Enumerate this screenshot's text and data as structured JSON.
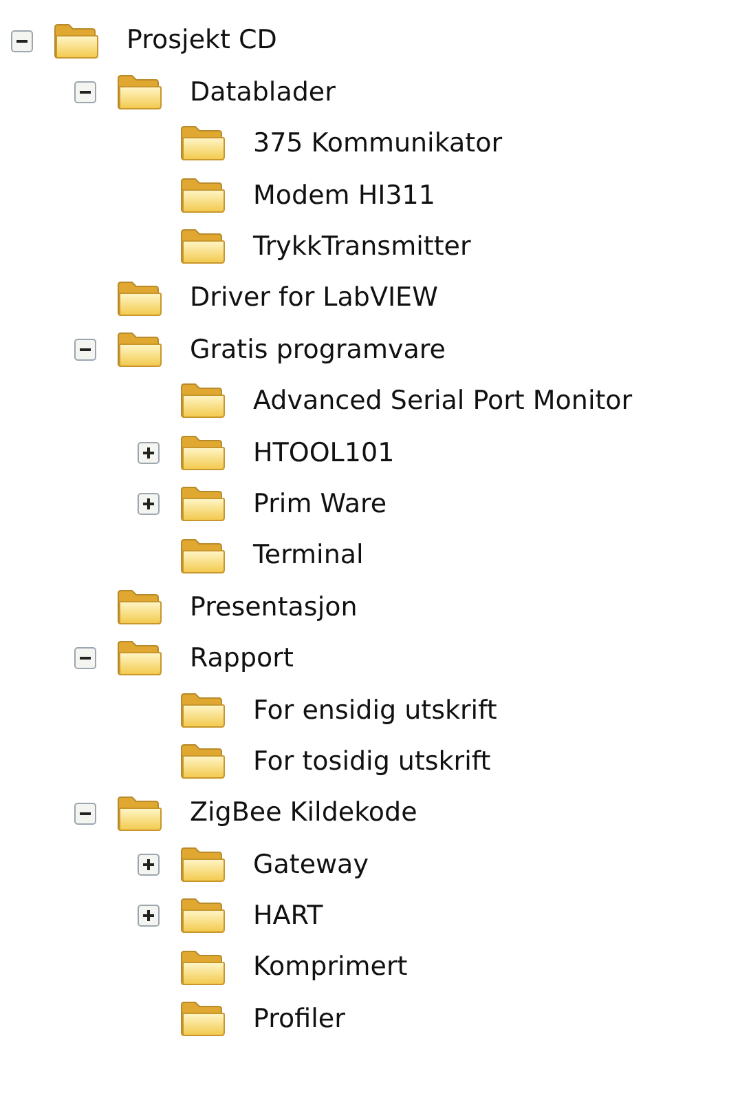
{
  "tree": [
    {
      "label": "Prosjekt CD",
      "expanded": true,
      "children": [
        {
          "label": "Datablader",
          "expanded": true,
          "children": [
            {
              "label": "375 Kommunikator"
            },
            {
              "label": "Modem HI311"
            },
            {
              "label": "TrykkTransmitter"
            }
          ]
        },
        {
          "label": "Driver for LabVIEW"
        },
        {
          "label": "Gratis programvare",
          "expanded": true,
          "children": [
            {
              "label": "Advanced Serial Port Monitor"
            },
            {
              "label": "HTOOL101",
              "expanded": false
            },
            {
              "label": "Prim Ware",
              "expanded": false
            },
            {
              "label": "Terminal"
            }
          ]
        },
        {
          "label": "Presentasjon"
        },
        {
          "label": "Rapport",
          "expanded": true,
          "children": [
            {
              "label": "For ensidig utskrift"
            },
            {
              "label": "For tosidig utskrift"
            }
          ]
        },
        {
          "label": "ZigBee Kildekode",
          "expanded": true,
          "children": [
            {
              "label": "Gateway",
              "expanded": false
            },
            {
              "label": "HART",
              "expanded": false
            },
            {
              "label": "Komprimert"
            },
            {
              "label": "Profiler"
            }
          ]
        }
      ]
    }
  ]
}
